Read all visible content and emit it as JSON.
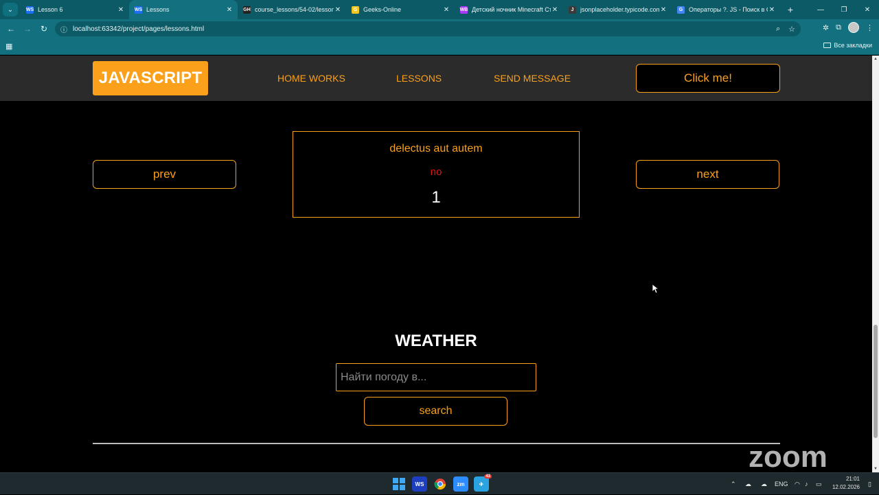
{
  "browser": {
    "tabs": [
      {
        "title": "Lesson 6",
        "fav": "WS",
        "fav_color": "#1d6ef5",
        "active": false
      },
      {
        "title": "Lessons",
        "fav": "WS",
        "fav_color": "#1d6ef5",
        "active": true
      },
      {
        "title": "course_lessons/54-02/lesson6/...",
        "fav": "GH",
        "fav_color": "#222222",
        "active": false
      },
      {
        "title": "Geeks-Online",
        "fav": "G",
        "fav_color": "#f3c623",
        "active": false
      },
      {
        "title": "Детский ночник Minecraft Сти...",
        "fav": "WB",
        "fav_color": "#a73afd",
        "active": false
      },
      {
        "title": "jsonplaceholder.typicode.com/...",
        "fav": "J",
        "fav_color": "#3a3a3a",
        "active": false
      },
      {
        "title": "Операторы ?. JS - Поиск в Goo...",
        "fav": "G",
        "fav_color": "#4285f4",
        "active": false
      }
    ],
    "new_tab_symbol": "+",
    "url": "localhost:63342/project/pages/lessons.html",
    "bookmarks_all_label": "Все закладки"
  },
  "site": {
    "logo": "JAVASCRIPT",
    "nav": [
      "HOME WORKS",
      "LESSONS",
      "SEND MESSAGE"
    ],
    "click_button": "Click me!",
    "prev_button": "prev",
    "next_button": "next",
    "card": {
      "title": "delectus aut autem",
      "status": "no",
      "id": "1"
    },
    "weather": {
      "title": "WEATHER",
      "placeholder": "Найти погоду в...",
      "search_button": "search"
    }
  },
  "watermark": "zoom",
  "taskbar": {
    "lang": "ENG",
    "time": "21:01",
    "date": "12.02.2026",
    "telegram_badge": "43"
  },
  "colors": {
    "accent": "#fba01a",
    "status_red": "#e01515",
    "header_bg": "#2b2b2b",
    "browser_teal": "#13707e"
  }
}
